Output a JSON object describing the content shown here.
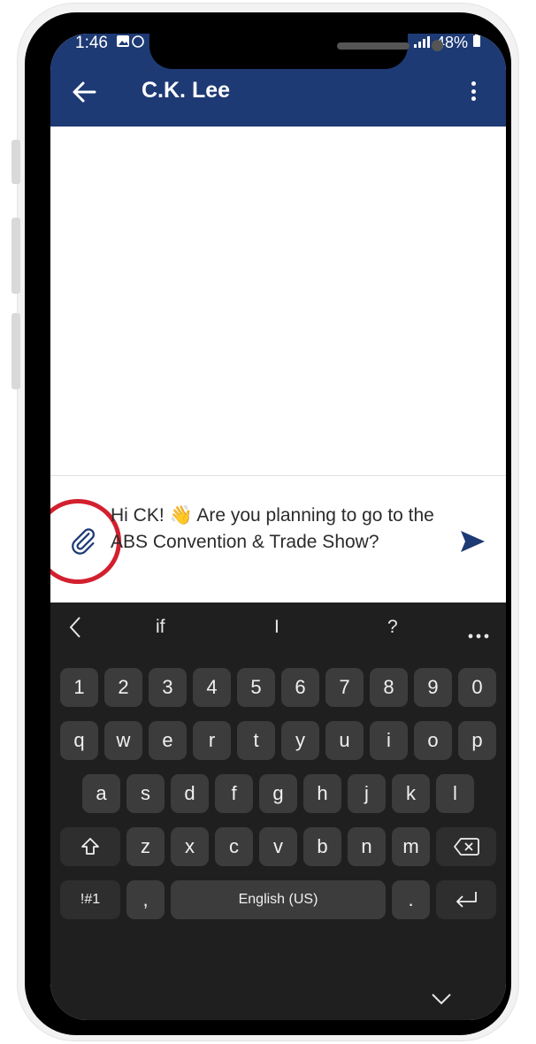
{
  "status_bar": {
    "time": "1:46",
    "battery": "48%"
  },
  "header": {
    "title": "C.K. Lee"
  },
  "compose": {
    "message": "Hi CK! 👋 Are you planning to go to the ABS Convention & Trade Show?"
  },
  "keyboard": {
    "suggestions": [
      "if",
      "I",
      "?"
    ],
    "number_row": [
      "1",
      "2",
      "3",
      "4",
      "5",
      "6",
      "7",
      "8",
      "9",
      "0"
    ],
    "row1": [
      "q",
      "w",
      "e",
      "r",
      "t",
      "y",
      "u",
      "i",
      "o",
      "p"
    ],
    "row2": [
      "a",
      "s",
      "d",
      "f",
      "g",
      "h",
      "j",
      "k",
      "l"
    ],
    "row3": [
      "z",
      "x",
      "c",
      "v",
      "b",
      "n",
      "m"
    ],
    "symbols_label": "!#1",
    "comma": ",",
    "space_label": "English (US)",
    "period": "."
  },
  "colors": {
    "app_bar": "#1e3a74",
    "accent": "#1e3a74",
    "highlight": "#d2202f",
    "keyboard_bg": "#1f1f1f",
    "key_bg": "#3c3c3c"
  },
  "icons": [
    "back-arrow-icon",
    "more-vertical-icon",
    "paperclip-icon",
    "send-icon",
    "chevron-left-icon",
    "more-horizontal-icon",
    "shift-icon",
    "backspace-icon",
    "enter-icon",
    "chevron-down-icon"
  ]
}
